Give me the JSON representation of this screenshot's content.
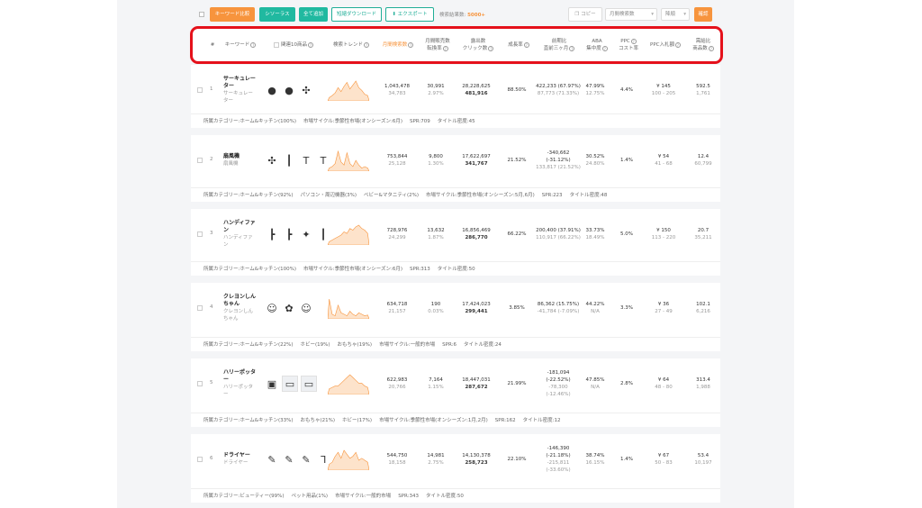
{
  "toolbar": {
    "compare": "キーワード比較",
    "thesaurus": "シソーラス",
    "add_all": "全て追加",
    "download_short": "短縮ダウンロード",
    "export": "エクスポート",
    "result_label": "検索結果数:",
    "result_count": "5000+",
    "copy": "コピー",
    "sort_select": "月間検索数",
    "order_select": "降順",
    "confirm": "確認"
  },
  "headers": {
    "num": "#",
    "keyword": "キーワード",
    "related": "関連10商品",
    "trend": "検索トレンド",
    "monthly_search": "月間検索数",
    "monthly_sales_1": "月間販売数",
    "monthly_sales_2": "転換率",
    "impressions_1": "露出数",
    "impressions_2": "クリック数",
    "growth": "成長率",
    "yoy_1": "前期比",
    "yoy_2": "直前三ヶ月",
    "aba_1": "ABA",
    "aba_2": "集中度",
    "ppc_cost_1": "PPC",
    "ppc_cost_2": "コスト率",
    "ppc_bid": "PPC入札額",
    "ratio_1": "需給比",
    "ratio_2": "商品数"
  },
  "rows": [
    {
      "num": "1",
      "kw1": "サーキュレー",
      "kw2": "ター",
      "kw3": "サーキュレー",
      "kw4": "ター",
      "search": "1,043,478",
      "search_sub": "34,783",
      "sales": "30,991",
      "sales_sub": "2.97%",
      "imp": "28,228,625",
      "imp_sub": "481,916",
      "growth": "88.50%",
      "yoy1": "422,233 (67.97%)",
      "yoy2": "87,773 (71.33%)",
      "yoy3": "",
      "aba": "47.99%",
      "aba_sub": "12.75%",
      "ppc": "4.4%",
      "bid": "¥ 145",
      "bid_sub": "100 - 205",
      "ratio": "592.5",
      "ratio_sub": "1,761",
      "foot": [
        {
          "label": "所属カテゴリー:",
          "value": "ホーム&キッチン(100%)"
        },
        {
          "label": "市場サイクル:",
          "value": "季節性市場(オンシーズン:6月)"
        },
        {
          "label": "SPR:",
          "value": "709"
        },
        {
          "label": "タイトル密度:",
          "value": "45"
        }
      ]
    },
    {
      "num": "2",
      "kw1": "扇風機",
      "kw2": "扇風機",
      "kw3": "",
      "kw4": "",
      "search": "753,844",
      "search_sub": "25,128",
      "sales": "9,800",
      "sales_sub": "1.30%",
      "imp": "17,622,697",
      "imp_sub": "341,767",
      "growth": "21.52%",
      "yoy1": "-340,662",
      "yoy2": "(-31.12%)",
      "yoy3": "133,817 (21.52%)",
      "aba": "30.52%",
      "aba_sub": "24.80%",
      "ppc": "1.4%",
      "bid": "¥ 54",
      "bid_sub": "41 - 68",
      "ratio": "12.4",
      "ratio_sub": "60,799",
      "foot": [
        {
          "label": "所属カテゴリー:",
          "value": "ホーム&キッチン(92%)"
        },
        {
          "label": "",
          "value": "パソコン・周辺機器(3%)"
        },
        {
          "label": "",
          "value": "ベビー&マタニティ(2%)"
        },
        {
          "label": "市場サイクル:",
          "value": "季節性市場(オンシーズン:5月,6月)"
        },
        {
          "label": "SPR:",
          "value": "223"
        },
        {
          "label": "タイトル密度:",
          "value": "48"
        }
      ]
    },
    {
      "num": "3",
      "kw1": "ハンディファ",
      "kw2": "ン",
      "kw3": "ハンディファ",
      "kw4": "ン",
      "search": "728,976",
      "search_sub": "24,299",
      "sales": "13,632",
      "sales_sub": "1.87%",
      "imp": "16,856,469",
      "imp_sub": "286,770",
      "growth": "66.22%",
      "yoy1": "200,400 (37.91%)",
      "yoy2": "110,917 (66.22%)",
      "yoy3": "",
      "aba": "33.73%",
      "aba_sub": "18.49%",
      "ppc": "5.0%",
      "bid": "¥ 150",
      "bid_sub": "113 - 220",
      "ratio": "20.7",
      "ratio_sub": "35,211",
      "foot": [
        {
          "label": "所属カテゴリー:",
          "value": "ホーム&キッチン(100%)"
        },
        {
          "label": "市場サイクル:",
          "value": "季節性市場(オンシーズン:6月)"
        },
        {
          "label": "SPR:",
          "value": "313"
        },
        {
          "label": "タイトル密度:",
          "value": "50"
        }
      ]
    },
    {
      "num": "4",
      "kw1": "クレヨンしん",
      "kw2": "ちゃん",
      "kw3": "クレヨンしん",
      "kw4": "ちゃん",
      "search": "634,718",
      "search_sub": "21,157",
      "sales": "190",
      "sales_sub": "0.03%",
      "imp": "17,424,023",
      "imp_sub": "299,441",
      "growth": "3.85%",
      "yoy1": "86,362 (15.75%)",
      "yoy2": "-41,784 (-7.09%)",
      "yoy3": "",
      "aba": "44.22%",
      "aba_sub": "N/A",
      "ppc": "3.3%",
      "bid": "¥ 36",
      "bid_sub": "27 - 49",
      "ratio": "102.1",
      "ratio_sub": "6,216",
      "foot": [
        {
          "label": "所属カテゴリー:",
          "value": "ホーム&キッチン(22%)"
        },
        {
          "label": "",
          "value": "ホビー(19%)"
        },
        {
          "label": "",
          "value": "おもちゃ(19%)"
        },
        {
          "label": "市場サイクル:",
          "value": "一般的市場"
        },
        {
          "label": "SPR:",
          "value": "6"
        },
        {
          "label": "タイトル密度:",
          "value": "24"
        }
      ]
    },
    {
      "num": "5",
      "kw1": "ハリーポッタ",
      "kw2": "ー",
      "kw3": "ハリーポッタ",
      "kw4": "ー",
      "search": "622,983",
      "search_sub": "20,766",
      "sales": "7,164",
      "sales_sub": "1.15%",
      "imp": "18,447,031",
      "imp_sub": "287,672",
      "growth": "21.99%",
      "yoy1": "-181,094",
      "yoy2": "(-22.52%)",
      "yoy3": "-78,300",
      "yoy4": "(-12.46%)",
      "aba": "47.85%",
      "aba_sub": "N/A",
      "ppc": "2.8%",
      "bid": "¥ 64",
      "bid_sub": "48 - 80",
      "ratio": "313.4",
      "ratio_sub": "1,988",
      "foot": [
        {
          "label": "所属カテゴリー:",
          "value": "ホーム&キッチン(33%)"
        },
        {
          "label": "",
          "value": "おもちゃ(21%)"
        },
        {
          "label": "",
          "value": "ホビー(17%)"
        },
        {
          "label": "市場サイクル:",
          "value": "季節性市場(オンシーズン:1月,2月)"
        },
        {
          "label": "SPR:",
          "value": "162"
        },
        {
          "label": "タイトル密度:",
          "value": "12"
        }
      ]
    },
    {
      "num": "6",
      "kw1": "ドライヤー",
      "kw2": "ドライヤー",
      "kw3": "",
      "kw4": "",
      "search": "544,750",
      "search_sub": "18,158",
      "sales": "14,981",
      "sales_sub": "2.75%",
      "imp": "14,130,378",
      "imp_sub": "258,723",
      "growth": "22.10%",
      "yoy1": "-146,390",
      "yoy2": "(-21.18%)",
      "yoy3": "-215,811",
      "yoy4": "(-33.60%)",
      "aba": "38.74%",
      "aba_sub": "16.15%",
      "ppc": "1.4%",
      "bid": "¥ 67",
      "bid_sub": "50 - 83",
      "ratio": "53.4",
      "ratio_sub": "10,197",
      "foot": [
        {
          "label": "所属カテゴリー:",
          "value": "ビューティー(99%)"
        },
        {
          "label": "",
          "value": "ペット用品(1%)"
        },
        {
          "label": "市場サイクル:",
          "value": "一般的市場"
        },
        {
          "label": "SPR:",
          "value": "343"
        },
        {
          "label": "タイトル密度:",
          "value": "50"
        }
      ]
    }
  ],
  "trend_series": [
    [
      5,
      8,
      12,
      20,
      14,
      22,
      28,
      18,
      24,
      30,
      20,
      16,
      10,
      8
    ],
    [
      4,
      6,
      10,
      26,
      12,
      8,
      24,
      10,
      6,
      14,
      8,
      4,
      6,
      4
    ],
    [
      4,
      6,
      8,
      10,
      12,
      16,
      14,
      20,
      18,
      22,
      24,
      20,
      18,
      14
    ],
    [
      26,
      6,
      4,
      18,
      8,
      6,
      4,
      10,
      6,
      4,
      8,
      6,
      4,
      5
    ],
    [
      4,
      5,
      6,
      6,
      8,
      10,
      12,
      14,
      12,
      10,
      8,
      8,
      6,
      5
    ],
    [
      6,
      8,
      14,
      18,
      12,
      20,
      16,
      12,
      14,
      18,
      10,
      12,
      10,
      8
    ]
  ],
  "colors": {
    "accent": "#f7943d",
    "teal": "#20b9a0",
    "highlight": "#e5111b"
  }
}
